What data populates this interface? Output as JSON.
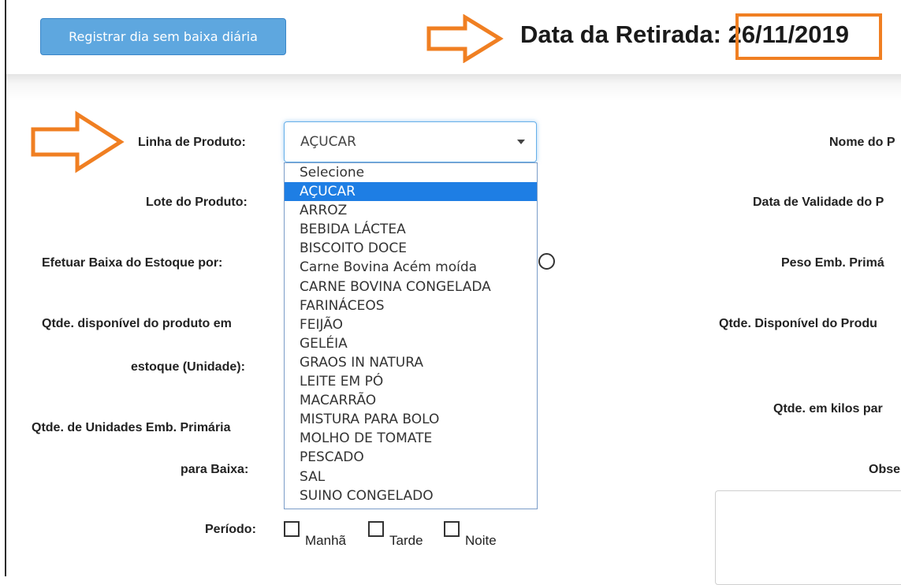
{
  "toolbar": {
    "register_button": "Registrar dia sem baixa diária"
  },
  "header": {
    "date_label": "Data da Retirada: ",
    "date_value": "26/11/2019"
  },
  "annotation_color": "#f07f22",
  "form": {
    "linha_label": "Linha de Produto:",
    "linha_selected": "AÇUCAR",
    "lote_label": "Lote do Produto:",
    "baixa_label": "Efetuar Baixa do Estoque por:",
    "qtde_disp_label_1": "Qtde. disponível do produto em",
    "qtde_disp_label_2": "estoque (Unidade):",
    "qtde_unid_label_1": "Qtde. de Unidades Emb. Primária",
    "qtde_unid_label_2": "para Baixa:",
    "periodo_label": "Período:",
    "periodo_options": [
      "Manhã",
      "Tarde",
      "Noite"
    ]
  },
  "right_column": {
    "nome_label": "Nome do P",
    "validade_label": "Data de Validade do P",
    "peso_label": "Peso Emb. Primá",
    "qtde_disp_label": "Qtde. Disponível do Produ",
    "qtde_kilos_label": "Qtde. em kilos par",
    "obs_label": "Obse"
  },
  "dropdown": {
    "selected_index": 1,
    "options": [
      "Selecione",
      "AÇUCAR",
      "ARROZ",
      "BEBIDA LÁCTEA",
      "BISCOITO DOCE",
      "Carne Bovina Acém moída",
      "CARNE BOVINA CONGELADA",
      "FARINÁCEOS",
      "FEIJÃO",
      "GELÉIA",
      "GRAOS IN NATURA",
      "LEITE EM PÓ",
      "MACARRÃO",
      "MISTURA PARA BOLO",
      "MOLHO DE TOMATE",
      "PESCADO",
      "SAL",
      "SUINO CONGELADO"
    ]
  }
}
